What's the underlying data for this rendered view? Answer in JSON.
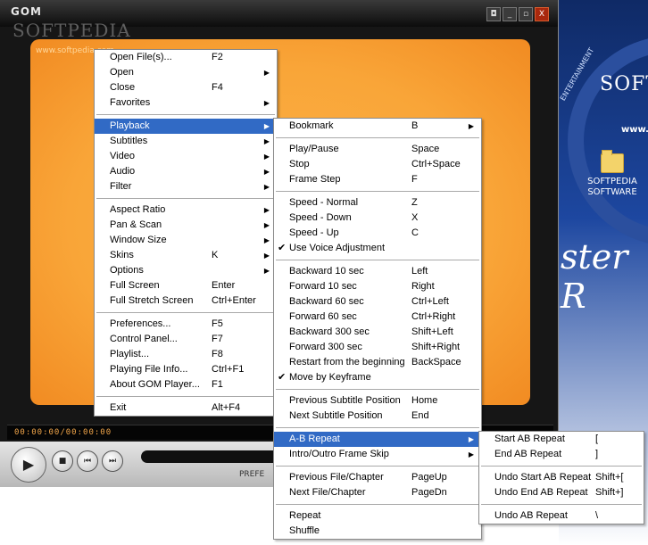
{
  "player": {
    "logo": "GOM",
    "watermark": "SOFTPEDIA",
    "watermark_url": "www.softpedia.com",
    "time": "00:00:00/00:00:00",
    "play_icon": "▶",
    "stop_icon": "■",
    "prev_icon": "⏮",
    "next_icon": "⏭",
    "pref_label": "PREFE",
    "window_buttons": [
      "◘",
      "_",
      "▫",
      "X"
    ]
  },
  "desktop": {
    "brand": "SOFT",
    "url": "www.",
    "script": "ster R",
    "arc_text": "ENTERTAINMENT",
    "icon_label_1": "SOFTPEDIA",
    "icon_label_2": "SOFTWARE"
  },
  "menu_main": [
    {
      "label": "Open File(s)...",
      "shortcut": "F2"
    },
    {
      "label": "Open",
      "submenu": true
    },
    {
      "label": "Close",
      "shortcut": "F4"
    },
    {
      "label": "Favorites",
      "submenu": true
    },
    {
      "sep": true
    },
    {
      "label": "Playback",
      "submenu": true,
      "highlight": true
    },
    {
      "label": "Subtitles",
      "submenu": true
    },
    {
      "label": "Video",
      "submenu": true
    },
    {
      "label": "Audio",
      "submenu": true
    },
    {
      "label": "Filter",
      "submenu": true
    },
    {
      "sep": true
    },
    {
      "label": "Aspect Ratio",
      "submenu": true
    },
    {
      "label": "Pan & Scan",
      "submenu": true
    },
    {
      "label": "Window Size",
      "submenu": true
    },
    {
      "label": "Skins",
      "shortcut": "K",
      "submenu": true
    },
    {
      "label": "Options",
      "submenu": true
    },
    {
      "label": "Full Screen",
      "shortcut": "Enter"
    },
    {
      "label": "Full Stretch Screen",
      "shortcut": "Ctrl+Enter"
    },
    {
      "sep": true
    },
    {
      "label": "Preferences...",
      "shortcut": "F5"
    },
    {
      "label": "Control Panel...",
      "shortcut": "F7"
    },
    {
      "label": "Playlist...",
      "shortcut": "F8"
    },
    {
      "label": "Playing File Info...",
      "shortcut": "Ctrl+F1"
    },
    {
      "label": "About GOM Player...",
      "shortcut": "F1"
    },
    {
      "sep": true
    },
    {
      "label": "Exit",
      "shortcut": "Alt+F4"
    }
  ],
  "menu_playback": [
    {
      "label": "Bookmark",
      "shortcut": "B",
      "submenu": true
    },
    {
      "sep": true
    },
    {
      "label": "Play/Pause",
      "shortcut": "Space"
    },
    {
      "label": "Stop",
      "shortcut": "Ctrl+Space"
    },
    {
      "label": "Frame Step",
      "shortcut": "F"
    },
    {
      "sep": true
    },
    {
      "label": "Speed - Normal",
      "shortcut": "Z"
    },
    {
      "label": "Speed - Down",
      "shortcut": "X"
    },
    {
      "label": "Speed - Up",
      "shortcut": "C"
    },
    {
      "label": "Use Voice Adjustment",
      "checked": true
    },
    {
      "sep": true
    },
    {
      "label": "Backward 10 sec",
      "shortcut": "Left"
    },
    {
      "label": "Forward 10 sec",
      "shortcut": "Right"
    },
    {
      "label": "Backward 60 sec",
      "shortcut": "Ctrl+Left"
    },
    {
      "label": "Forward 60 sec",
      "shortcut": "Ctrl+Right"
    },
    {
      "label": "Backward 300 sec",
      "shortcut": "Shift+Left"
    },
    {
      "label": "Forward 300 sec",
      "shortcut": "Shift+Right"
    },
    {
      "label": "Restart from the beginning",
      "shortcut": "BackSpace"
    },
    {
      "label": "Move by Keyframe",
      "checked": true
    },
    {
      "sep": true
    },
    {
      "label": "Previous Subtitle Position",
      "shortcut": "Home"
    },
    {
      "label": "Next Subtitle Position",
      "shortcut": "End"
    },
    {
      "sep": true
    },
    {
      "label": "A-B Repeat",
      "submenu": true,
      "highlight": true
    },
    {
      "label": "Intro/Outro Frame Skip",
      "submenu": true
    },
    {
      "sep": true
    },
    {
      "label": "Previous File/Chapter",
      "shortcut": "PageUp"
    },
    {
      "label": "Next File/Chapter",
      "shortcut": "PageDn"
    },
    {
      "sep": true
    },
    {
      "label": "Repeat"
    },
    {
      "label": "Shuffle"
    }
  ],
  "menu_ab": [
    {
      "label": "Start AB Repeat",
      "shortcut": "["
    },
    {
      "label": "End AB Repeat",
      "shortcut": "]"
    },
    {
      "sep": true
    },
    {
      "label": "Undo Start AB Repeat",
      "shortcut": "Shift+["
    },
    {
      "label": "Undo End AB Repeat",
      "shortcut": "Shift+]"
    },
    {
      "sep": true
    },
    {
      "label": "Undo AB Repeat",
      "shortcut": "\\"
    }
  ]
}
